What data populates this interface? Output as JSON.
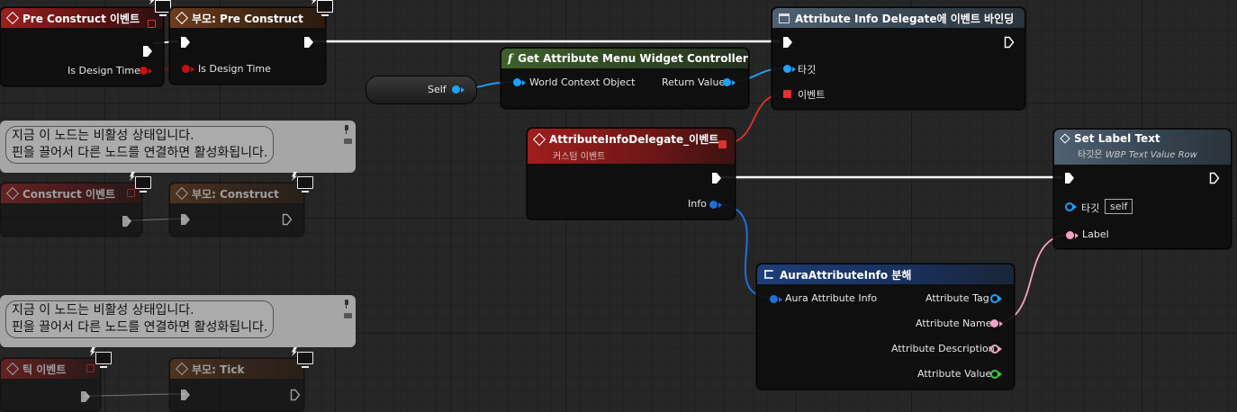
{
  "nodes": {
    "pre_construct_event": {
      "title": "Pre Construct 이벤트",
      "is_design_time": "Is Design Time"
    },
    "parent_pre_construct": {
      "title": "부모: Pre Construct",
      "is_design_time": "Is Design Time"
    },
    "bind_event": {
      "title": "Attribute Info Delegate에 이벤트 바인딩",
      "target": "타깃",
      "event": "이벤트"
    },
    "get_controller": {
      "title": "Get Attribute Menu Widget Controller",
      "world_context": "World Context Object",
      "return_value": "Return Value"
    },
    "self_node": {
      "label": "Self"
    },
    "custom_event": {
      "title": "AttributeInfoDelegate_이벤트",
      "subtitle": "커스텀 이벤트",
      "info": "Info"
    },
    "set_label_text": {
      "title": "Set Label Text",
      "subtitle_prefix": "타깃은",
      "subtitle_class": "WBP Text Value Row",
      "target": "타깃",
      "target_value": "self",
      "label": "Label"
    },
    "break_struct": {
      "title": "AuraAttributeInfo 분해",
      "input": "Aura Attribute Info",
      "tag": "Attribute Tag",
      "name": "Attribute Name",
      "description": "Attribute Description",
      "value": "Attribute Value"
    },
    "construct_event": {
      "title": "Construct 이벤트"
    },
    "parent_construct": {
      "title": "부모: Construct"
    },
    "tick_event": {
      "title": "틱 이벤트"
    },
    "parent_tick": {
      "title": "부모: Tick"
    }
  },
  "comments": [
    {
      "line1": "지금 이 노드는 비활성 상태입니다.",
      "line2": "핀을 끌어서 다른 노드를 연결하면 활성화됩니다."
    },
    {
      "line1": "지금 이 노드는 비활성 상태입니다.",
      "line2": "핀을 끌어서 다른 노드를 연결하면 활성화됩니다."
    }
  ],
  "colors": {
    "exec": "#ffffff",
    "object_pin": "#1aa3ff",
    "delegate_pin": "#e03030",
    "struct_pin": "#1f6fd8",
    "text_pin": "#f2a2c2",
    "float_pin": "#3ccb3c",
    "event_header": "#9a2020",
    "function_header": "#3e5f2b"
  }
}
